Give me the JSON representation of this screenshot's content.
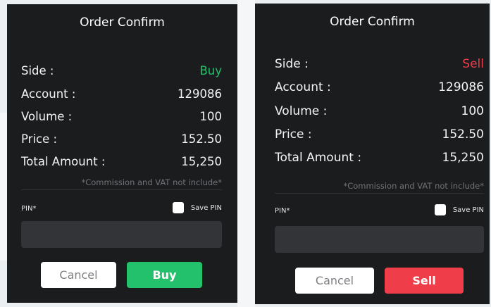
{
  "dialogs": [
    {
      "title": "Order Confirm",
      "side_label": "Side :",
      "side_value": "Buy",
      "account_label": "Account :",
      "account_value": "129086",
      "volume_label": "Volume :",
      "volume_value": "100",
      "price_label": "Price :",
      "price_value": "152.50",
      "total_label": "Total Amount :",
      "total_value": "15,250",
      "note": "*Commission and VAT not include*",
      "pin_label": "PIN*",
      "save_pin_label": "Save PIN",
      "pin_value": "",
      "cancel_label": "Cancel",
      "confirm_label": "Buy"
    },
    {
      "title": "Order Confirm",
      "side_label": "Side :",
      "side_value": "Sell",
      "account_label": "Account :",
      "account_value": "129086",
      "volume_label": "Volume :",
      "volume_value": "100",
      "price_label": "Price :",
      "price_value": "152.50",
      "total_label": "Total Amount :",
      "total_value": "15,250",
      "note": "*Commission and VAT not include*",
      "pin_label": "PIN*",
      "save_pin_label": "Save PIN",
      "pin_value": "",
      "cancel_label": "Cancel",
      "confirm_label": "Sell"
    }
  ],
  "colors": {
    "buy": "#23c16b",
    "sell": "#ef3e4a",
    "dialog_bg": "#1b1c1e",
    "input_bg": "#323438"
  }
}
